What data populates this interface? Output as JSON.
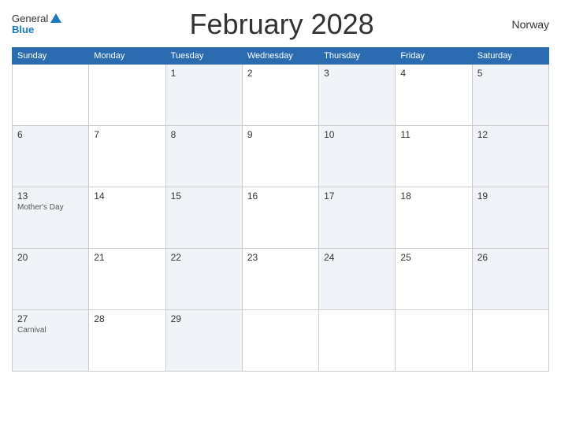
{
  "header": {
    "logo_general": "General",
    "logo_blue": "Blue",
    "title": "February 2028",
    "country": "Norway"
  },
  "days_of_week": [
    "Sunday",
    "Monday",
    "Tuesday",
    "Wednesday",
    "Thursday",
    "Friday",
    "Saturday"
  ],
  "weeks": [
    [
      {
        "day": "",
        "event": "",
        "empty": true
      },
      {
        "day": "",
        "event": "",
        "empty": true
      },
      {
        "day": "1",
        "event": ""
      },
      {
        "day": "2",
        "event": ""
      },
      {
        "day": "3",
        "event": ""
      },
      {
        "day": "4",
        "event": ""
      },
      {
        "day": "5",
        "event": ""
      }
    ],
    [
      {
        "day": "6",
        "event": ""
      },
      {
        "day": "7",
        "event": ""
      },
      {
        "day": "8",
        "event": ""
      },
      {
        "day": "9",
        "event": ""
      },
      {
        "day": "10",
        "event": ""
      },
      {
        "day": "11",
        "event": ""
      },
      {
        "day": "12",
        "event": ""
      }
    ],
    [
      {
        "day": "13",
        "event": "Mother's Day"
      },
      {
        "day": "14",
        "event": ""
      },
      {
        "day": "15",
        "event": ""
      },
      {
        "day": "16",
        "event": ""
      },
      {
        "day": "17",
        "event": ""
      },
      {
        "day": "18",
        "event": ""
      },
      {
        "day": "19",
        "event": ""
      }
    ],
    [
      {
        "day": "20",
        "event": ""
      },
      {
        "day": "21",
        "event": ""
      },
      {
        "day": "22",
        "event": ""
      },
      {
        "day": "23",
        "event": ""
      },
      {
        "day": "24",
        "event": ""
      },
      {
        "day": "25",
        "event": ""
      },
      {
        "day": "26",
        "event": ""
      }
    ],
    [
      {
        "day": "27",
        "event": "Carnival"
      },
      {
        "day": "28",
        "event": ""
      },
      {
        "day": "29",
        "event": ""
      },
      {
        "day": "",
        "event": "",
        "empty": true
      },
      {
        "day": "",
        "event": "",
        "empty": true
      },
      {
        "day": "",
        "event": "",
        "empty": true
      },
      {
        "day": "",
        "event": "",
        "empty": true
      }
    ]
  ]
}
